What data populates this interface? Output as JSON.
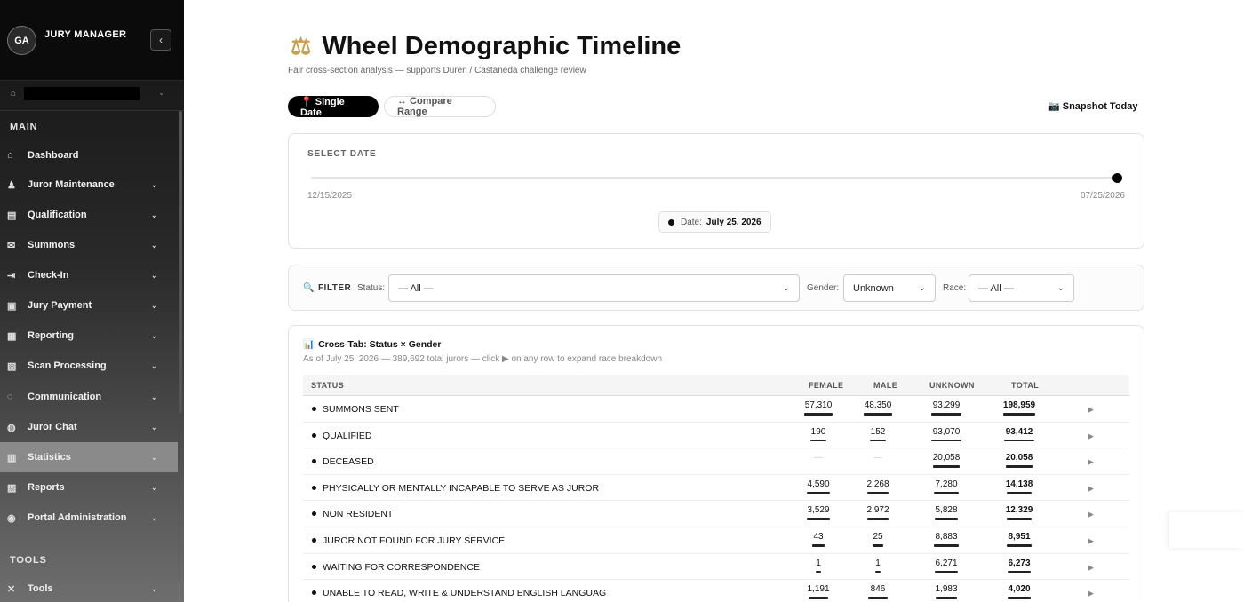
{
  "sidebar": {
    "avatar_initials": "GA",
    "app_name": "JURY MANAGER",
    "collapse_icon": "‹",
    "main_section": "MAIN",
    "tools_section": "TOOLS",
    "items": [
      {
        "label": "Dashboard",
        "icon": "⌂",
        "chev": ""
      },
      {
        "label": "Juror Maintenance",
        "icon": "♟",
        "chev": "⌄"
      },
      {
        "label": "Qualification",
        "icon": "▤",
        "chev": "⌄"
      },
      {
        "label": "Summons",
        "icon": "✉",
        "chev": "⌄"
      },
      {
        "label": "Check-In",
        "icon": "⇥",
        "chev": "⌄"
      },
      {
        "label": "Jury Payment",
        "icon": "▣",
        "chev": "⌄"
      },
      {
        "label": "Reporting",
        "icon": "▦",
        "chev": "⌄"
      },
      {
        "label": "Scan Processing",
        "icon": "▧",
        "chev": "⌄"
      },
      {
        "label": "Communication",
        "icon": "◌",
        "chev": "⌄"
      },
      {
        "label": "Juror Chat",
        "icon": "◍",
        "chev": "⌄"
      },
      {
        "label": "Statistics",
        "icon": "▥",
        "chev": "⌄"
      },
      {
        "label": "Reports",
        "icon": "▨",
        "chev": "⌄"
      },
      {
        "label": "Portal Administration",
        "icon": "◉",
        "chev": "⌄"
      }
    ],
    "tools_item": {
      "label": "Tools",
      "icon": "✕",
      "chev": "⌄"
    }
  },
  "header": {
    "title_icon": "⚖",
    "title": "Wheel Demographic Timeline",
    "subtitle": "Fair cross-section analysis — supports Duren / Castaneda challenge review",
    "mode_single": "📍 Single Date",
    "mode_compare": "↔ Compare Range",
    "snapshot": "📷 Snapshot Today"
  },
  "date_card": {
    "label": "SELECT DATE",
    "range_start": "12/15/2025",
    "range_end": "07/25/2026",
    "slider_position": 1.0,
    "date_prefix": "Date:",
    "date_value": "July 25, 2026"
  },
  "filter": {
    "title": "FILTER",
    "title_icon": "🔍",
    "status_label": "Status:",
    "status_value": "— All —",
    "gender_label": "Gender:",
    "gender_value": "Unknown",
    "race_label": "Race:",
    "race_value": "— All —",
    "chev": "⌄"
  },
  "table": {
    "title_icon": "📊",
    "title": "Cross-Tab: Status × Gender",
    "subtitle": "As of July 25, 2026 — 389,692 total jurors — click ▶ on any row to expand race breakdown",
    "headers": {
      "status": "STATUS",
      "female": "FEMALE",
      "male": "MALE",
      "unknown": "UNKNOWN",
      "total": "TOTAL"
    },
    "rows": [
      {
        "status": "SUMMONS SENT",
        "female": "57,310",
        "male": "48,350",
        "unknown": "93,299",
        "total": "198,959",
        "expand": "▶"
      },
      {
        "status": "QUALIFIED",
        "female": "190",
        "male": "152",
        "unknown": "93,070",
        "total": "93,412",
        "expand": "▶"
      },
      {
        "status": "DECEASED",
        "female": "—",
        "male": "—",
        "unknown": "20,058",
        "total": "20,058",
        "expand": "▶"
      },
      {
        "status": "PHYSICALLY OR MENTALLY INCAPABLE TO SERVE AS JUROR",
        "female": "4,590",
        "male": "2,268",
        "unknown": "7,280",
        "total": "14,138",
        "expand": "▶"
      },
      {
        "status": "NON RESIDENT",
        "female": "3,529",
        "male": "2,972",
        "unknown": "5,828",
        "total": "12,329",
        "expand": "▶"
      },
      {
        "status": "JUROR NOT FOUND FOR JURY SERVICE",
        "female": "43",
        "male": "25",
        "unknown": "8,883",
        "total": "8,951",
        "expand": "▶"
      },
      {
        "status": "WAITING FOR CORRESPONDENCE",
        "female": "1",
        "male": "1",
        "unknown": "6,271",
        "total": "6,273",
        "expand": "▶"
      },
      {
        "status": "UNABLE TO READ, WRITE & UNDERSTAND ENGLISH LANGUAG",
        "female": "1,191",
        "male": "846",
        "unknown": "1,983",
        "total": "4,020",
        "expand": "▶"
      }
    ]
  }
}
